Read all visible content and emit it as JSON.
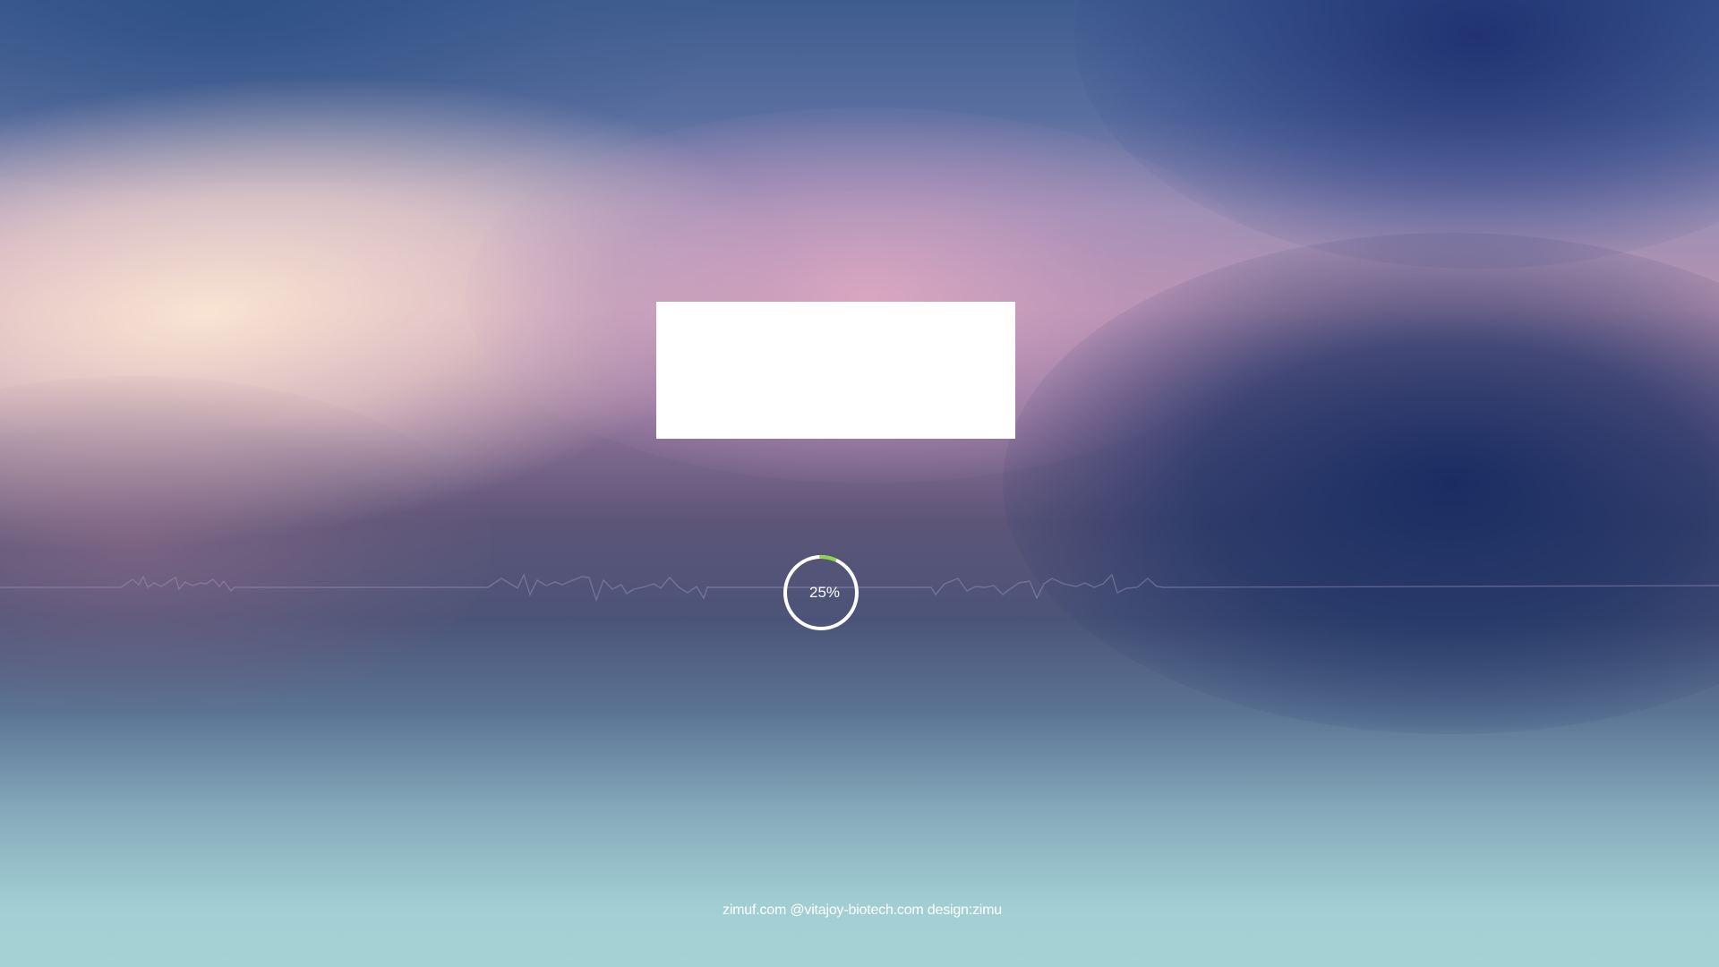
{
  "loader": {
    "percent_label": "25%",
    "progress": 0.25,
    "track_color": "#ffffff",
    "progress_color": "#8ed44a"
  },
  "footer": {
    "credit_text": "zimuf.com @vitajoy-biotech.com design:zimu"
  },
  "logo_placeholder": {
    "color": "#ffffff"
  },
  "background": {
    "colors": [
      "#3e5c8e",
      "#f2e4d6",
      "#d8aac0",
      "#15295f",
      "#a5d3d5"
    ]
  }
}
